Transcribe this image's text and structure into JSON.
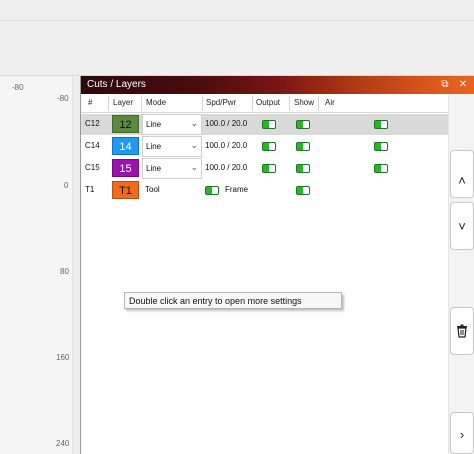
{
  "ruler": {
    "top_label": "-80",
    "labels": [
      "-80",
      "0",
      "80",
      "160",
      "240"
    ]
  },
  "panel": {
    "title": "Cuts / Layers",
    "float_icon": "⧉",
    "close_icon": "✕",
    "columns": [
      "#",
      "Layer",
      "Mode",
      "Spd/Pwr",
      "Output",
      "Show",
      "Air"
    ],
    "rows": [
      {
        "id": "C12",
        "layer": "12",
        "layer_color": "#5b8a3c",
        "layer_text_color": "#111111",
        "mode": "Line",
        "spd_pwr": "100.0 / 20.0",
        "output": true,
        "show": true,
        "air": true,
        "selected": true
      },
      {
        "id": "C14",
        "layer": "14",
        "layer_color": "#1e9bf0",
        "layer_text_color": "#ffffff",
        "mode": "Line",
        "spd_pwr": "100.0 / 20.0",
        "output": true,
        "show": true,
        "air": true,
        "selected": false
      },
      {
        "id": "C15",
        "layer": "15",
        "layer_color": "#9c11b0",
        "layer_text_color": "#ffffff",
        "mode": "Line",
        "spd_pwr": "100.0 / 20.0",
        "output": true,
        "show": true,
        "air": true,
        "selected": false
      },
      {
        "id": "T1",
        "layer": "T1",
        "layer_color": "#f26a1b",
        "layer_text_color": "#111111",
        "mode": "Tool",
        "frame_label": "Frame",
        "output": true,
        "show": true,
        "selected": false
      }
    ],
    "tooltip": "Double click an entry to open more settings"
  },
  "side_buttons": {
    "up": "⌃",
    "down": "⌄",
    "delete": "trash-icon",
    "next": "›"
  },
  "colors": {
    "toggle_on": "#2bb32b",
    "header_dark": "#2e0a0a",
    "header_light": "#e8641e"
  }
}
